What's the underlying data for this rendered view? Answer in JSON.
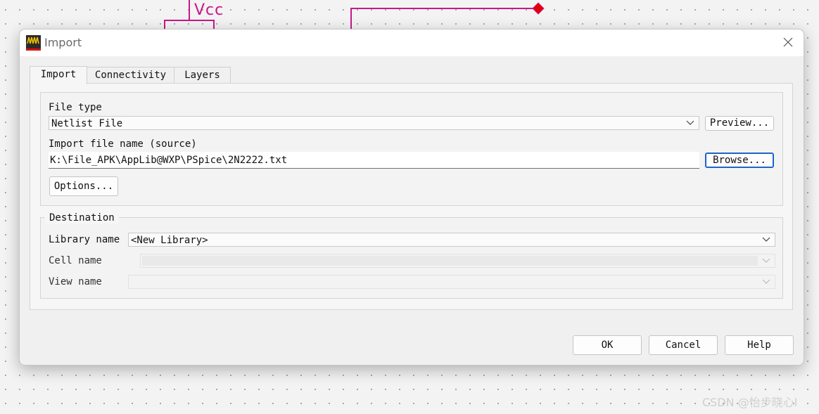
{
  "background": {
    "vcc_label": "Vcc",
    "wire_color": "#c8188a",
    "pin_color": "#e00000"
  },
  "dialog": {
    "title": "Import",
    "app_icon": "virtuoso-app-icon",
    "close_icon": "close-icon"
  },
  "tabs": [
    {
      "label": "Import",
      "active": true
    },
    {
      "label": "Connectivity",
      "active": false
    },
    {
      "label": "Layers",
      "active": false
    }
  ],
  "source": {
    "file_type_label": "File type",
    "file_type_value": "Netlist File",
    "preview_button": "Preview...",
    "file_name_label": "Import file name (source)",
    "file_name_value": "K:\\File_APK\\AppLib@WXP\\PSpice\\2N2222.txt",
    "browse_button": "Browse...",
    "options_button": "Options..."
  },
  "destination": {
    "legend": "Destination",
    "library_label": "Library name",
    "library_value": "<New Library>",
    "cell_label": "Cell name",
    "cell_value": "",
    "view_label": "View name",
    "view_value": ""
  },
  "footer": {
    "ok": "OK",
    "cancel": "Cancel",
    "help": "Help"
  },
  "watermark": "CSDN @怡步晓心l",
  "colors": {
    "focus_border": "#1e63c6",
    "dialog_bg": "#f0f0f0"
  }
}
